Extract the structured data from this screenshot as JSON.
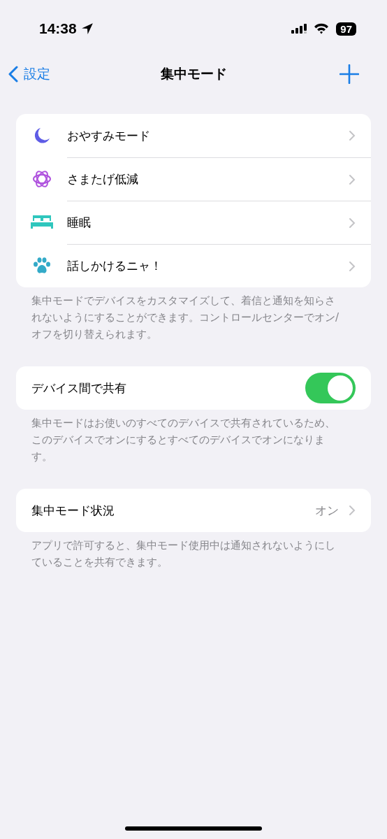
{
  "status_bar": {
    "time": "14:38",
    "battery": "97"
  },
  "nav": {
    "back": "設定",
    "title": "集中モード"
  },
  "modes": [
    {
      "kind": "moon",
      "color": "#5e5ce6",
      "label": "おやすみモード"
    },
    {
      "kind": "flower",
      "color": "#af52de",
      "label": "さまたげ低減"
    },
    {
      "kind": "bed",
      "color": "#2fc6bd",
      "label": "睡眠"
    },
    {
      "kind": "paw",
      "color": "#33aac8",
      "label": "話しかけるニャ！"
    }
  ],
  "modes_footer": "集中モードでデバイスをカスタマイズして、着信と通知を知らされないようにすることができます。コントロールセンターでオン/オフを切り替えられます。",
  "share": {
    "label": "デバイス間で共有",
    "on": true
  },
  "share_footer": "集中モードはお使いのすべてのデバイスで共有されているため、このデバイスでオンにするとすべてのデバイスでオンになります。",
  "status": {
    "label": "集中モード状況",
    "value": "オン"
  },
  "status_footer": "アプリで許可すると、集中モード使用中は通知されないようにしていることを共有できます。"
}
